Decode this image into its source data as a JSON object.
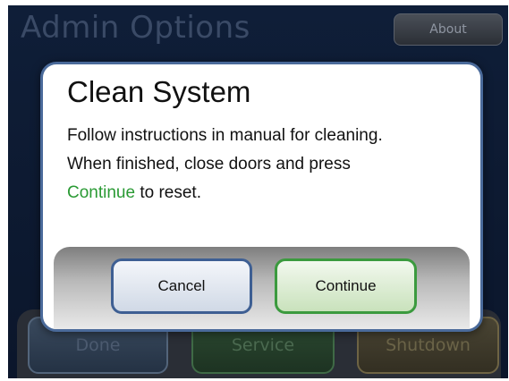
{
  "background": {
    "title": "Admin Options",
    "about_label": "About",
    "buttons": {
      "done_label": "Done",
      "service_label": "Service",
      "shutdown_label": "Shutdown"
    }
  },
  "dialog": {
    "title": "Clean System",
    "line1": "Follow instructions in manual for cleaning.",
    "line2": "When finished, close doors and press",
    "line3_highlight": "Continue",
    "line3_rest": " to reset.",
    "cancel_label": "Cancel",
    "continue_label": "Continue"
  },
  "colors": {
    "highlight": "#2a9a34",
    "cancel_border": "#3e5f93",
    "continue_border": "#3b9a3e",
    "screen_background": "#0f1e38"
  }
}
